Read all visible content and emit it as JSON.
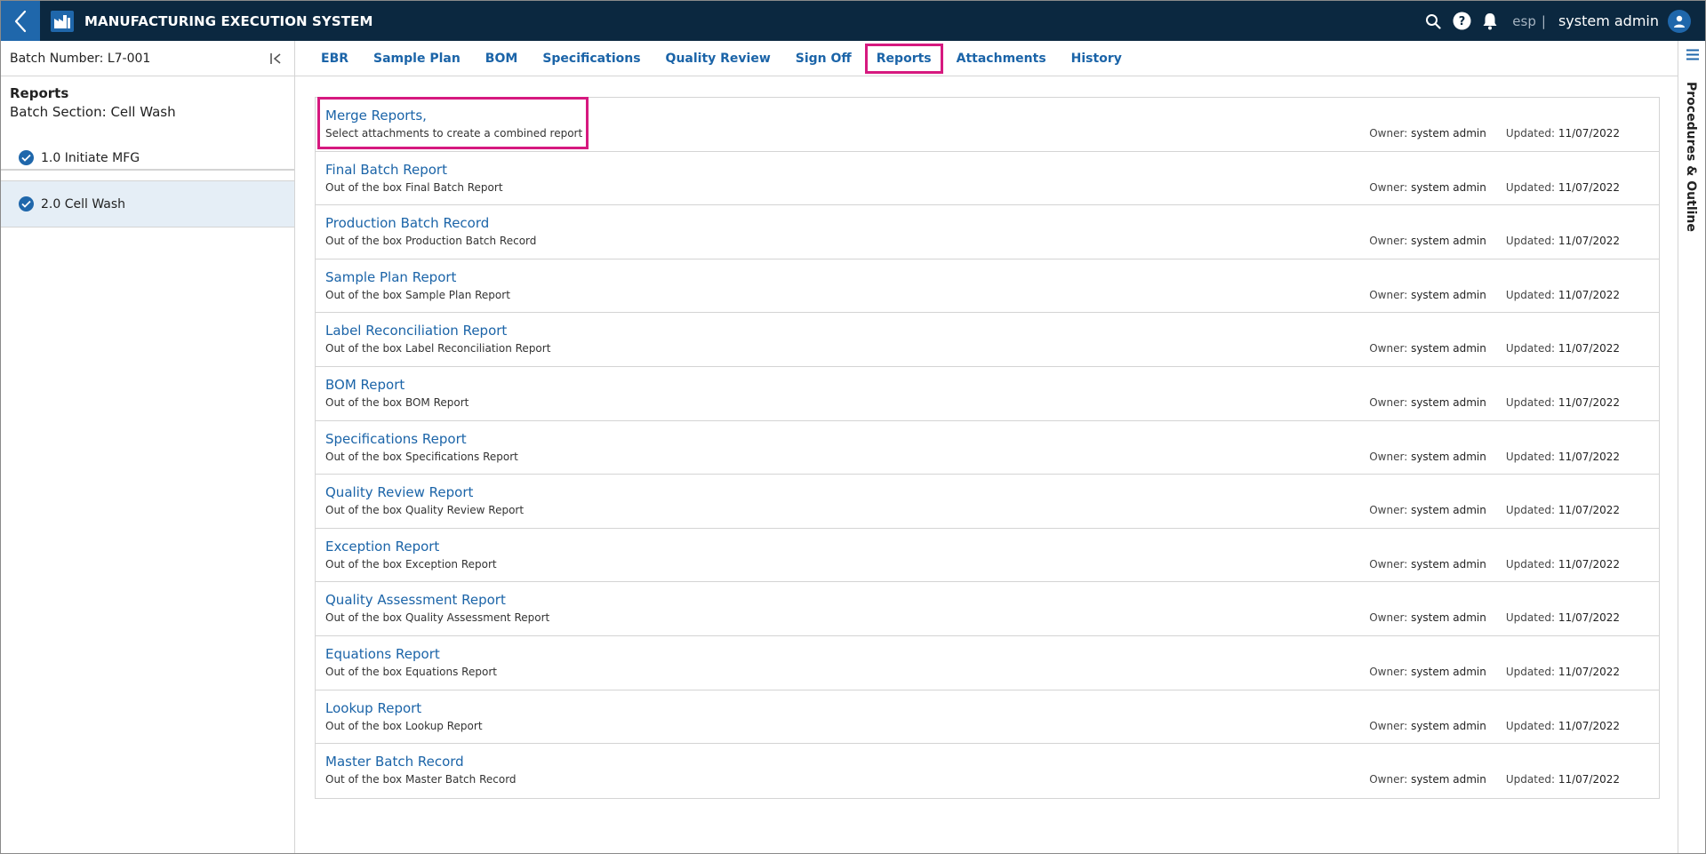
{
  "app": {
    "title": "MANUFACTURING EXECUTION SYSTEM",
    "language": "esp",
    "language_separator": "|",
    "user": "system admin"
  },
  "colors": {
    "topbar": "#0b2840",
    "accent": "#1f67ab",
    "highlight": "#d6197f"
  },
  "left_panel": {
    "batch_number": "Batch Number: L7-001",
    "section_title": "Reports",
    "section_subtitle": "Batch Section: Cell Wash",
    "items": [
      {
        "label": "1.0 Initiate MFG",
        "status": "complete"
      },
      {
        "label": "2.0 Cell Wash",
        "status": "complete",
        "selected": true
      }
    ]
  },
  "tabs": [
    {
      "label": "EBR"
    },
    {
      "label": "Sample Plan"
    },
    {
      "label": "BOM"
    },
    {
      "label": "Specifications"
    },
    {
      "label": "Quality Review"
    },
    {
      "label": "Sign Off"
    },
    {
      "label": "Reports",
      "active": true
    },
    {
      "label": "Attachments"
    },
    {
      "label": "History"
    }
  ],
  "right_rail": {
    "label": "Procedures & Outline"
  },
  "report_meta_labels": {
    "owner": "Owner:",
    "updated": "Updated:"
  },
  "reports": [
    {
      "name": "Merge Reports,",
      "description": "Select attachments to create a combined report",
      "owner": "system admin",
      "updated": "11/07/2022"
    },
    {
      "name": "Final Batch Report",
      "description": "Out of the box Final Batch Report",
      "owner": "system admin",
      "updated": "11/07/2022"
    },
    {
      "name": "Production Batch Record",
      "description": "Out of the box Production Batch Record",
      "owner": "system admin",
      "updated": "11/07/2022"
    },
    {
      "name": "Sample Plan Report",
      "description": "Out of the box Sample Plan Report",
      "owner": "system admin",
      "updated": "11/07/2022"
    },
    {
      "name": "Label Reconciliation Report",
      "description": "Out of the box Label Reconciliation Report",
      "owner": "system admin",
      "updated": "11/07/2022"
    },
    {
      "name": "BOM Report",
      "description": "Out of the box BOM Report",
      "owner": "system admin",
      "updated": "11/07/2022"
    },
    {
      "name": "Specifications Report",
      "description": "Out of the box Specifications Report",
      "owner": "system admin",
      "updated": "11/07/2022"
    },
    {
      "name": "Quality Review Report",
      "description": "Out of the box Quality Review Report",
      "owner": "system admin",
      "updated": "11/07/2022"
    },
    {
      "name": "Exception Report",
      "description": "Out of the box Exception Report",
      "owner": "system admin",
      "updated": "11/07/2022"
    },
    {
      "name": "Quality Assessment Report",
      "description": "Out of the box Quality Assessment Report",
      "owner": "system admin",
      "updated": "11/07/2022"
    },
    {
      "name": "Equations Report",
      "description": "Out of the box Equations Report",
      "owner": "system admin",
      "updated": "11/07/2022"
    },
    {
      "name": "Lookup Report",
      "description": "Out of the box Lookup Report",
      "owner": "system admin",
      "updated": "11/07/2022"
    },
    {
      "name": "Master Batch Record",
      "description": "Out of the box Master Batch Record",
      "owner": "system admin",
      "updated": "11/07/2022"
    }
  ]
}
